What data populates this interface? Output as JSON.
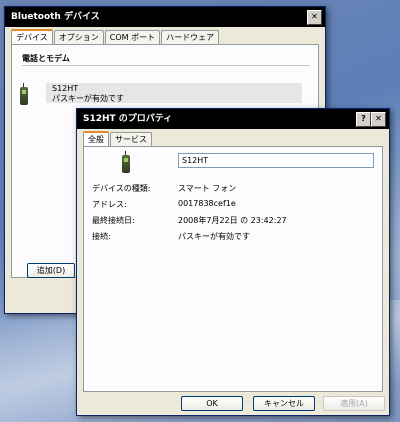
{
  "bt_window": {
    "title": "Bluetooth デバイス",
    "tabs": [
      "デバイス",
      "オプション",
      "COM ポート",
      "ハードウェア"
    ],
    "section_title": "電話とモデム",
    "device_name": "S12HT",
    "device_status": "パスキーが有効です",
    "add_button": "追加(D)"
  },
  "props_window": {
    "title": "S12HT のプロパティ",
    "help_glyph": "?",
    "tabs": [
      "全般",
      "サービス"
    ],
    "name_value": "S12HT",
    "fields": [
      {
        "label": "デバイスの種類:",
        "value": "スマート フォン"
      },
      {
        "label": "アドレス:",
        "value": "0017838cef1e"
      },
      {
        "label": "最終接続日:",
        "value": "2008年7月22日 の 23:42:27"
      },
      {
        "label": "接続:",
        "value": "パスキーが有効です"
      }
    ],
    "buttons": {
      "ok": "OK",
      "cancel": "キャンセル",
      "apply": "適用(A)"
    }
  },
  "icons": {
    "close": "close-icon",
    "help": "help-icon",
    "device": "phone-icon"
  }
}
